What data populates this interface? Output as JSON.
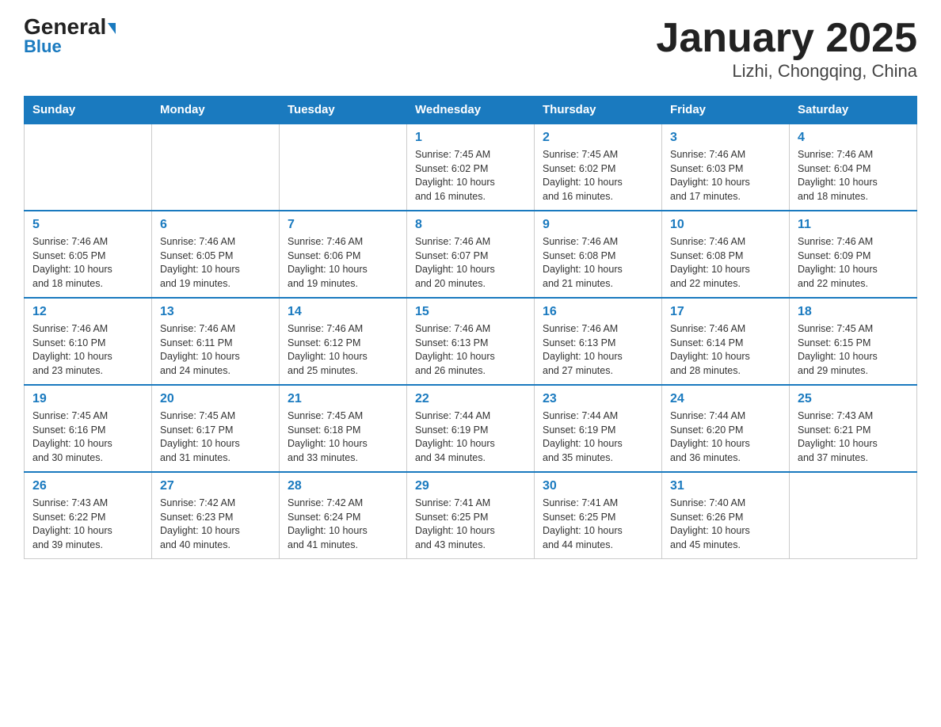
{
  "header": {
    "logo_general": "General",
    "logo_blue": "Blue",
    "title": "January 2025",
    "subtitle": "Lizhi, Chongqing, China"
  },
  "days_of_week": [
    "Sunday",
    "Monday",
    "Tuesday",
    "Wednesday",
    "Thursday",
    "Friday",
    "Saturday"
  ],
  "weeks": [
    [
      {
        "day": "",
        "info": ""
      },
      {
        "day": "",
        "info": ""
      },
      {
        "day": "",
        "info": ""
      },
      {
        "day": "1",
        "info": "Sunrise: 7:45 AM\nSunset: 6:02 PM\nDaylight: 10 hours\nand 16 minutes."
      },
      {
        "day": "2",
        "info": "Sunrise: 7:45 AM\nSunset: 6:02 PM\nDaylight: 10 hours\nand 16 minutes."
      },
      {
        "day": "3",
        "info": "Sunrise: 7:46 AM\nSunset: 6:03 PM\nDaylight: 10 hours\nand 17 minutes."
      },
      {
        "day": "4",
        "info": "Sunrise: 7:46 AM\nSunset: 6:04 PM\nDaylight: 10 hours\nand 18 minutes."
      }
    ],
    [
      {
        "day": "5",
        "info": "Sunrise: 7:46 AM\nSunset: 6:05 PM\nDaylight: 10 hours\nand 18 minutes."
      },
      {
        "day": "6",
        "info": "Sunrise: 7:46 AM\nSunset: 6:05 PM\nDaylight: 10 hours\nand 19 minutes."
      },
      {
        "day": "7",
        "info": "Sunrise: 7:46 AM\nSunset: 6:06 PM\nDaylight: 10 hours\nand 19 minutes."
      },
      {
        "day": "8",
        "info": "Sunrise: 7:46 AM\nSunset: 6:07 PM\nDaylight: 10 hours\nand 20 minutes."
      },
      {
        "day": "9",
        "info": "Sunrise: 7:46 AM\nSunset: 6:08 PM\nDaylight: 10 hours\nand 21 minutes."
      },
      {
        "day": "10",
        "info": "Sunrise: 7:46 AM\nSunset: 6:08 PM\nDaylight: 10 hours\nand 22 minutes."
      },
      {
        "day": "11",
        "info": "Sunrise: 7:46 AM\nSunset: 6:09 PM\nDaylight: 10 hours\nand 22 minutes."
      }
    ],
    [
      {
        "day": "12",
        "info": "Sunrise: 7:46 AM\nSunset: 6:10 PM\nDaylight: 10 hours\nand 23 minutes."
      },
      {
        "day": "13",
        "info": "Sunrise: 7:46 AM\nSunset: 6:11 PM\nDaylight: 10 hours\nand 24 minutes."
      },
      {
        "day": "14",
        "info": "Sunrise: 7:46 AM\nSunset: 6:12 PM\nDaylight: 10 hours\nand 25 minutes."
      },
      {
        "day": "15",
        "info": "Sunrise: 7:46 AM\nSunset: 6:13 PM\nDaylight: 10 hours\nand 26 minutes."
      },
      {
        "day": "16",
        "info": "Sunrise: 7:46 AM\nSunset: 6:13 PM\nDaylight: 10 hours\nand 27 minutes."
      },
      {
        "day": "17",
        "info": "Sunrise: 7:46 AM\nSunset: 6:14 PM\nDaylight: 10 hours\nand 28 minutes."
      },
      {
        "day": "18",
        "info": "Sunrise: 7:45 AM\nSunset: 6:15 PM\nDaylight: 10 hours\nand 29 minutes."
      }
    ],
    [
      {
        "day": "19",
        "info": "Sunrise: 7:45 AM\nSunset: 6:16 PM\nDaylight: 10 hours\nand 30 minutes."
      },
      {
        "day": "20",
        "info": "Sunrise: 7:45 AM\nSunset: 6:17 PM\nDaylight: 10 hours\nand 31 minutes."
      },
      {
        "day": "21",
        "info": "Sunrise: 7:45 AM\nSunset: 6:18 PM\nDaylight: 10 hours\nand 33 minutes."
      },
      {
        "day": "22",
        "info": "Sunrise: 7:44 AM\nSunset: 6:19 PM\nDaylight: 10 hours\nand 34 minutes."
      },
      {
        "day": "23",
        "info": "Sunrise: 7:44 AM\nSunset: 6:19 PM\nDaylight: 10 hours\nand 35 minutes."
      },
      {
        "day": "24",
        "info": "Sunrise: 7:44 AM\nSunset: 6:20 PM\nDaylight: 10 hours\nand 36 minutes."
      },
      {
        "day": "25",
        "info": "Sunrise: 7:43 AM\nSunset: 6:21 PM\nDaylight: 10 hours\nand 37 minutes."
      }
    ],
    [
      {
        "day": "26",
        "info": "Sunrise: 7:43 AM\nSunset: 6:22 PM\nDaylight: 10 hours\nand 39 minutes."
      },
      {
        "day": "27",
        "info": "Sunrise: 7:42 AM\nSunset: 6:23 PM\nDaylight: 10 hours\nand 40 minutes."
      },
      {
        "day": "28",
        "info": "Sunrise: 7:42 AM\nSunset: 6:24 PM\nDaylight: 10 hours\nand 41 minutes."
      },
      {
        "day": "29",
        "info": "Sunrise: 7:41 AM\nSunset: 6:25 PM\nDaylight: 10 hours\nand 43 minutes."
      },
      {
        "day": "30",
        "info": "Sunrise: 7:41 AM\nSunset: 6:25 PM\nDaylight: 10 hours\nand 44 minutes."
      },
      {
        "day": "31",
        "info": "Sunrise: 7:40 AM\nSunset: 6:26 PM\nDaylight: 10 hours\nand 45 minutes."
      },
      {
        "day": "",
        "info": ""
      }
    ]
  ]
}
